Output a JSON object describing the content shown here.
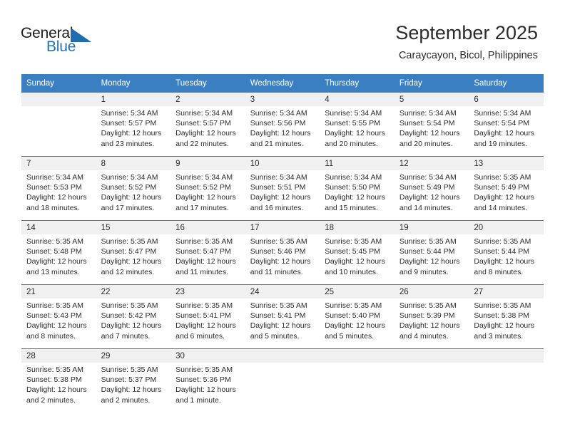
{
  "brand": {
    "name_top": "General",
    "name_bottom": "Blue",
    "accent_color": "#2272b8",
    "triangle_color": "#1f6cb0"
  },
  "header": {
    "title": "September 2025",
    "subtitle": "Caraycayon, Bicol, Philippines"
  },
  "calendar": {
    "header_bg": "#3a7fc1",
    "day_head_bg": "#f0f0f0",
    "weekday_headers": [
      "Sunday",
      "Monday",
      "Tuesday",
      "Wednesday",
      "Thursday",
      "Friday",
      "Saturday"
    ],
    "weeks": [
      [
        {
          "day": "",
          "sunrise": "",
          "sunset": "",
          "daylight": ""
        },
        {
          "day": "1",
          "sunrise": "Sunrise: 5:34 AM",
          "sunset": "Sunset: 5:57 PM",
          "daylight": "Daylight: 12 hours and 23 minutes."
        },
        {
          "day": "2",
          "sunrise": "Sunrise: 5:34 AM",
          "sunset": "Sunset: 5:57 PM",
          "daylight": "Daylight: 12 hours and 22 minutes."
        },
        {
          "day": "3",
          "sunrise": "Sunrise: 5:34 AM",
          "sunset": "Sunset: 5:56 PM",
          "daylight": "Daylight: 12 hours and 21 minutes."
        },
        {
          "day": "4",
          "sunrise": "Sunrise: 5:34 AM",
          "sunset": "Sunset: 5:55 PM",
          "daylight": "Daylight: 12 hours and 20 minutes."
        },
        {
          "day": "5",
          "sunrise": "Sunrise: 5:34 AM",
          "sunset": "Sunset: 5:54 PM",
          "daylight": "Daylight: 12 hours and 20 minutes."
        },
        {
          "day": "6",
          "sunrise": "Sunrise: 5:34 AM",
          "sunset": "Sunset: 5:54 PM",
          "daylight": "Daylight: 12 hours and 19 minutes."
        }
      ],
      [
        {
          "day": "7",
          "sunrise": "Sunrise: 5:34 AM",
          "sunset": "Sunset: 5:53 PM",
          "daylight": "Daylight: 12 hours and 18 minutes."
        },
        {
          "day": "8",
          "sunrise": "Sunrise: 5:34 AM",
          "sunset": "Sunset: 5:52 PM",
          "daylight": "Daylight: 12 hours and 17 minutes."
        },
        {
          "day": "9",
          "sunrise": "Sunrise: 5:34 AM",
          "sunset": "Sunset: 5:52 PM",
          "daylight": "Daylight: 12 hours and 17 minutes."
        },
        {
          "day": "10",
          "sunrise": "Sunrise: 5:34 AM",
          "sunset": "Sunset: 5:51 PM",
          "daylight": "Daylight: 12 hours and 16 minutes."
        },
        {
          "day": "11",
          "sunrise": "Sunrise: 5:34 AM",
          "sunset": "Sunset: 5:50 PM",
          "daylight": "Daylight: 12 hours and 15 minutes."
        },
        {
          "day": "12",
          "sunrise": "Sunrise: 5:34 AM",
          "sunset": "Sunset: 5:49 PM",
          "daylight": "Daylight: 12 hours and 14 minutes."
        },
        {
          "day": "13",
          "sunrise": "Sunrise: 5:35 AM",
          "sunset": "Sunset: 5:49 PM",
          "daylight": "Daylight: 12 hours and 14 minutes."
        }
      ],
      [
        {
          "day": "14",
          "sunrise": "Sunrise: 5:35 AM",
          "sunset": "Sunset: 5:48 PM",
          "daylight": "Daylight: 12 hours and 13 minutes."
        },
        {
          "day": "15",
          "sunrise": "Sunrise: 5:35 AM",
          "sunset": "Sunset: 5:47 PM",
          "daylight": "Daylight: 12 hours and 12 minutes."
        },
        {
          "day": "16",
          "sunrise": "Sunrise: 5:35 AM",
          "sunset": "Sunset: 5:47 PM",
          "daylight": "Daylight: 12 hours and 11 minutes."
        },
        {
          "day": "17",
          "sunrise": "Sunrise: 5:35 AM",
          "sunset": "Sunset: 5:46 PM",
          "daylight": "Daylight: 12 hours and 11 minutes."
        },
        {
          "day": "18",
          "sunrise": "Sunrise: 5:35 AM",
          "sunset": "Sunset: 5:45 PM",
          "daylight": "Daylight: 12 hours and 10 minutes."
        },
        {
          "day": "19",
          "sunrise": "Sunrise: 5:35 AM",
          "sunset": "Sunset: 5:44 PM",
          "daylight": "Daylight: 12 hours and 9 minutes."
        },
        {
          "day": "20",
          "sunrise": "Sunrise: 5:35 AM",
          "sunset": "Sunset: 5:44 PM",
          "daylight": "Daylight: 12 hours and 8 minutes."
        }
      ],
      [
        {
          "day": "21",
          "sunrise": "Sunrise: 5:35 AM",
          "sunset": "Sunset: 5:43 PM",
          "daylight": "Daylight: 12 hours and 8 minutes."
        },
        {
          "day": "22",
          "sunrise": "Sunrise: 5:35 AM",
          "sunset": "Sunset: 5:42 PM",
          "daylight": "Daylight: 12 hours and 7 minutes."
        },
        {
          "day": "23",
          "sunrise": "Sunrise: 5:35 AM",
          "sunset": "Sunset: 5:41 PM",
          "daylight": "Daylight: 12 hours and 6 minutes."
        },
        {
          "day": "24",
          "sunrise": "Sunrise: 5:35 AM",
          "sunset": "Sunset: 5:41 PM",
          "daylight": "Daylight: 12 hours and 5 minutes."
        },
        {
          "day": "25",
          "sunrise": "Sunrise: 5:35 AM",
          "sunset": "Sunset: 5:40 PM",
          "daylight": "Daylight: 12 hours and 5 minutes."
        },
        {
          "day": "26",
          "sunrise": "Sunrise: 5:35 AM",
          "sunset": "Sunset: 5:39 PM",
          "daylight": "Daylight: 12 hours and 4 minutes."
        },
        {
          "day": "27",
          "sunrise": "Sunrise: 5:35 AM",
          "sunset": "Sunset: 5:38 PM",
          "daylight": "Daylight: 12 hours and 3 minutes."
        }
      ],
      [
        {
          "day": "28",
          "sunrise": "Sunrise: 5:35 AM",
          "sunset": "Sunset: 5:38 PM",
          "daylight": "Daylight: 12 hours and 2 minutes."
        },
        {
          "day": "29",
          "sunrise": "Sunrise: 5:35 AM",
          "sunset": "Sunset: 5:37 PM",
          "daylight": "Daylight: 12 hours and 2 minutes."
        },
        {
          "day": "30",
          "sunrise": "Sunrise: 5:35 AM",
          "sunset": "Sunset: 5:36 PM",
          "daylight": "Daylight: 12 hours and 1 minute."
        },
        {
          "day": "",
          "sunrise": "",
          "sunset": "",
          "daylight": ""
        },
        {
          "day": "",
          "sunrise": "",
          "sunset": "",
          "daylight": ""
        },
        {
          "day": "",
          "sunrise": "",
          "sunset": "",
          "daylight": ""
        },
        {
          "day": "",
          "sunrise": "",
          "sunset": "",
          "daylight": ""
        }
      ]
    ]
  }
}
